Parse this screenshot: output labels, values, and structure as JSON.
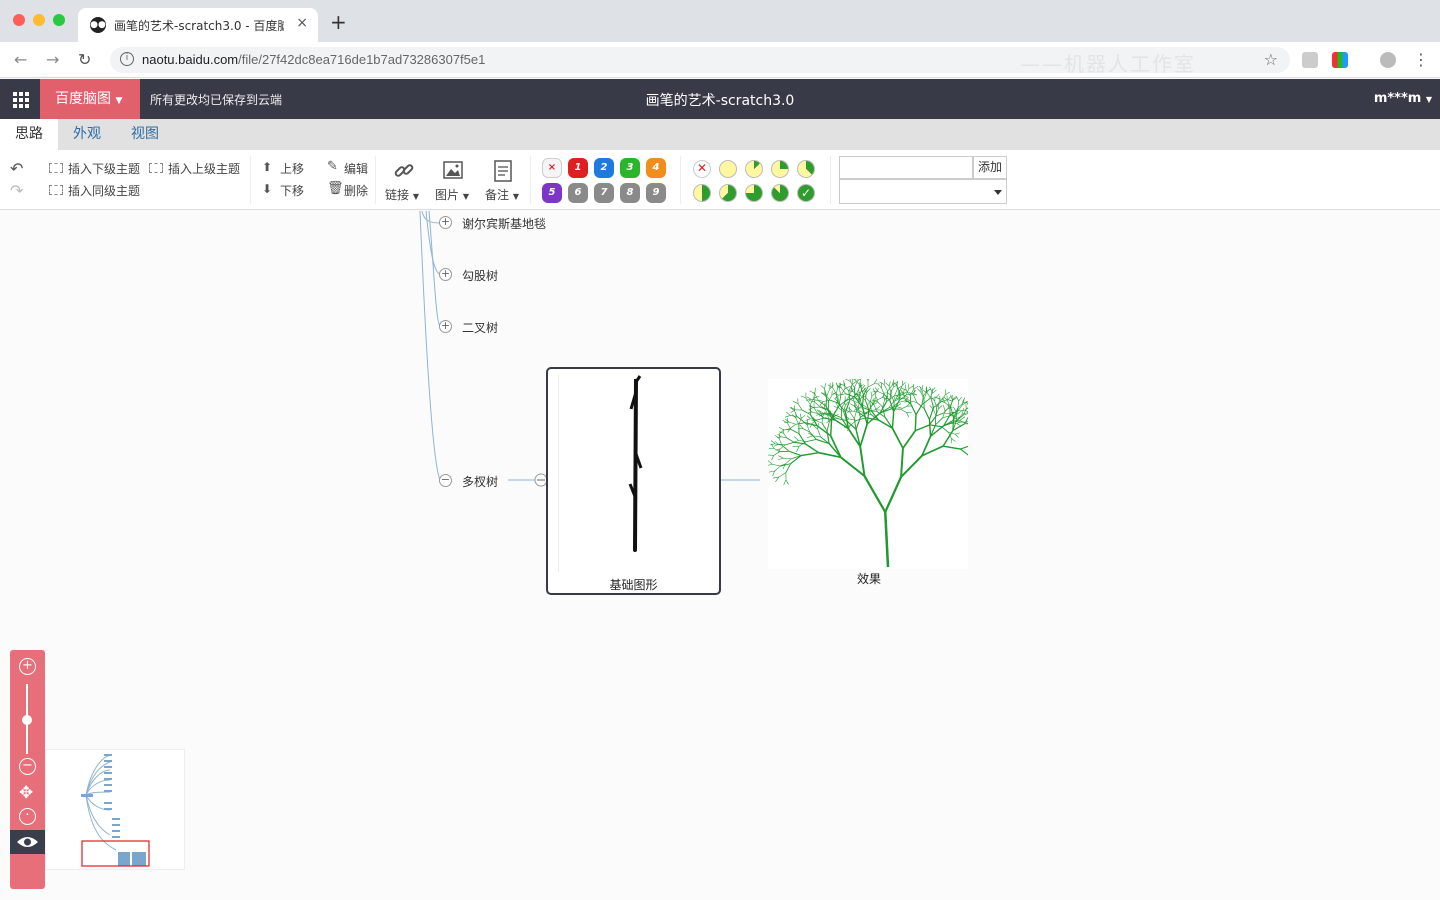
{
  "browser": {
    "tab_title": "画笔的艺术-scratch3.0 - 百度脑图",
    "tab_favicon": "owl-icon",
    "new_tab_label": "+",
    "close_tab_label": "×",
    "url_host": "naotu.baidu.com",
    "url_path": "/file/27f42dc8ea716de1b7ad73286307f5e1",
    "watermark": "——机器人工作室"
  },
  "app": {
    "brand": "百度脑图",
    "save_status": "所有更改均已保存到云端",
    "doc_title": "画笔的艺术-scratch3.0",
    "user": "m***m",
    "brand_color": "#e2606c",
    "header_color": "#383b47"
  },
  "menu_tabs": [
    {
      "label": "思路",
      "active": true
    },
    {
      "label": "外观",
      "active": false
    },
    {
      "label": "视图",
      "active": false
    }
  ],
  "toolbar": {
    "insert_child": "插入下级主题",
    "insert_parent": "插入上级主题",
    "insert_sibling": "插入同级主题",
    "move_up": "上移",
    "move_down": "下移",
    "edit": "编辑",
    "delete": "删除",
    "link": "链接",
    "image": "图片",
    "note": "备注",
    "priorities": [
      {
        "label": "×",
        "color": "#f5f5f5"
      },
      {
        "label": "1",
        "color": "#e02020"
      },
      {
        "label": "2",
        "color": "#1c7ae0"
      },
      {
        "label": "3",
        "color": "#2bb52b"
      },
      {
        "label": "4",
        "color": "#f18d1a"
      },
      {
        "label": "5",
        "color": "#7c35c8"
      },
      {
        "label": "6",
        "color": "#8a8a8a"
      },
      {
        "label": "7",
        "color": "#8a8a8a"
      },
      {
        "label": "8",
        "color": "#8a8a8a"
      },
      {
        "label": "9",
        "color": "#8a8a8a"
      }
    ],
    "tag_add_label": "添加",
    "tag_input_value": "",
    "tag_select_value": ""
  },
  "mindmap": {
    "nodes": [
      {
        "label": "谢尔宾斯基地毯",
        "expander": "+"
      },
      {
        "label": "勾股树",
        "expander": "+"
      },
      {
        "label": "二叉树",
        "expander": "+"
      },
      {
        "label": "多杈树",
        "expander": "−"
      }
    ],
    "selected_node_caption": "基础图形",
    "effect_node_caption": "效果",
    "tree_color": "#1e9a2e",
    "line_color": "#8fb3d3"
  }
}
